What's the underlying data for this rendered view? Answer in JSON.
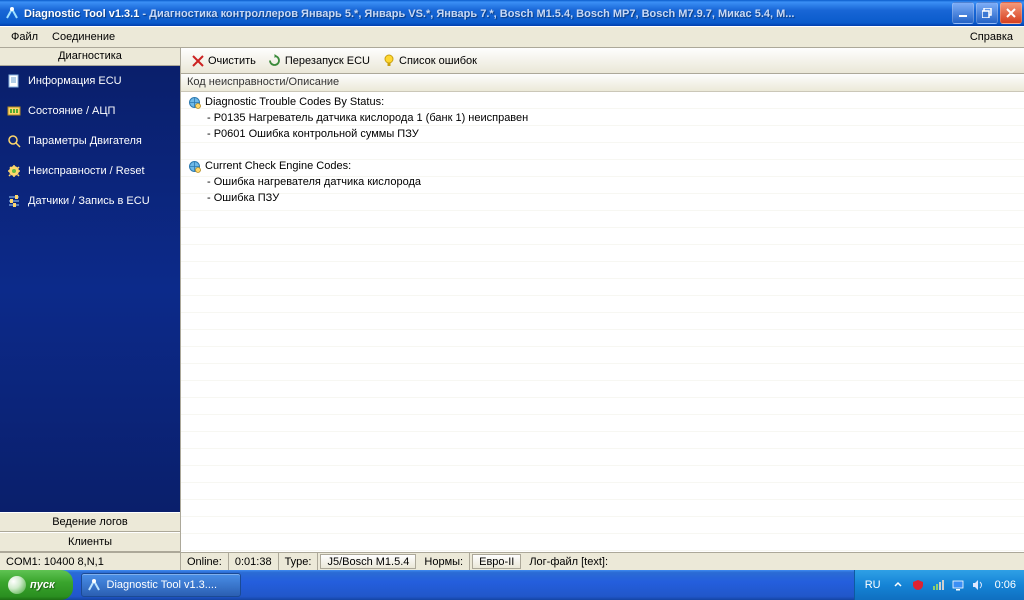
{
  "title": {
    "app": "Diagnostic Tool v1.3.1",
    "suffix": " - Диагностика контроллеров Январь 5.*, Январь VS.*, Январь 7.*, Bosch M1.5.4, Bosch MP7, Bosch M7.9.7, Микас 5.4, М..."
  },
  "menu": {
    "file": "Файл",
    "conn": "Соединение",
    "help": "Справка"
  },
  "sidebar": {
    "header": "Диагностика",
    "items": [
      {
        "label": "Информация ECU"
      },
      {
        "label": "Состояние / АЦП"
      },
      {
        "label": "Параметры Двигателя"
      },
      {
        "label": "Неисправности / Reset"
      },
      {
        "label": "Датчики / Запись в ECU"
      }
    ],
    "bottom1": "Ведение логов",
    "bottom2": "Клиенты"
  },
  "toolbar": {
    "clear": "Очистить",
    "restart": "Перезапуск ECU",
    "errlist": "Список ошибок"
  },
  "column_header": "Код неисправности/Описание",
  "rows": {
    "group1": "Diagnostic Trouble Codes By Status:",
    "g1a": "- P0135 Нагреватель датчика кислорода 1 (банк 1) неисправен",
    "g1b": "- P0601 Ошибка контрольной суммы ПЗУ",
    "group2": "Current Check Engine Codes:",
    "g2a": "- Ошибка нагревателя датчика кислорода",
    "g2b": "- Ошибка ПЗУ"
  },
  "status": {
    "com": "COM1: 10400 8,N,1",
    "online_lbl": "Online:",
    "online_time": "0:01:38",
    "type_lbl": "Type:",
    "type_val": "J5/Bosch M1.5.4",
    "norms_lbl": "Нормы:",
    "norms_val": "Евро-II",
    "log_lbl": "Лог-файл [text]:"
  },
  "taskbar": {
    "start": "пуск",
    "task1": "Diagnostic Tool v1.3....",
    "lang": "RU",
    "clock": "0:06"
  }
}
